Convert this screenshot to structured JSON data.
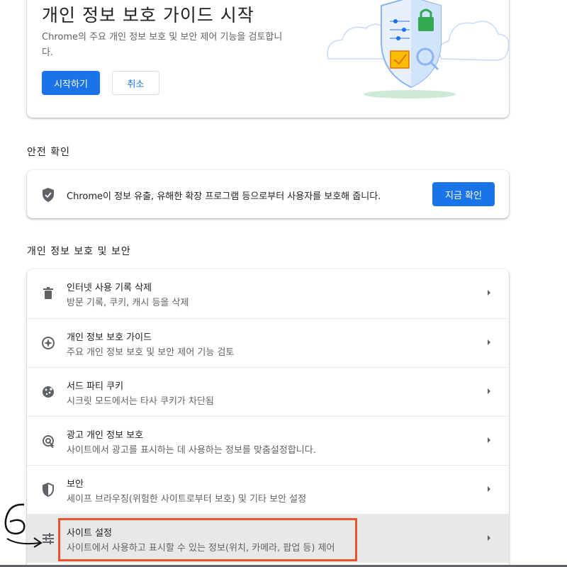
{
  "guide": {
    "title": "개인 정보 보호 가이드 시작",
    "description": "Chrome의 주요 개인 정보 보호 및 보안 제어 기능을 검토합니다.",
    "start_label": "시작하기",
    "cancel_label": "취소"
  },
  "safety": {
    "section_title": "안전 확인",
    "text": "Chrome이 정보 유출, 유해한 확장 프로그램 등으로부터 사용자를 보호해 줍니다.",
    "button_label": "지금 확인"
  },
  "privacy": {
    "section_title": "개인 정보 보호 및 보안",
    "items": [
      {
        "title": "인터넷 사용 기록 삭제",
        "subtitle": "방문 기록, 쿠키, 캐시 등을 삭제",
        "icon": "trash-icon"
      },
      {
        "title": "개인 정보 보호 가이드",
        "subtitle": "주요 개인 정보 보호 및 보안 제어 기능 검토",
        "icon": "compass-icon"
      },
      {
        "title": "서드 파티 쿠키",
        "subtitle": "시크릿 모드에서는 타사 쿠키가 차단됨",
        "icon": "cookie-icon"
      },
      {
        "title": "광고 개인 정보 보호",
        "subtitle": "사이트에서 광고를 표시하는 데 사용하는 정보를 맞춤설정합니다.",
        "icon": "ad-privacy-icon"
      },
      {
        "title": "보안",
        "subtitle": "세이프 브라우징(위험한 사이트로부터 보호) 및 기타 보안 설정",
        "icon": "shield-icon"
      },
      {
        "title": "사이트 설정",
        "subtitle": "사이트에서 사용하고 표시할 수 있는 정보(위치, 카메라, 팝업 등) 제어",
        "icon": "tune-icon"
      }
    ]
  },
  "annotation": {
    "step_number": "6",
    "highlight_color": "#e8532f"
  },
  "colors": {
    "accent": "#1a73e8",
    "highlight_row": "#e8e8e8"
  }
}
